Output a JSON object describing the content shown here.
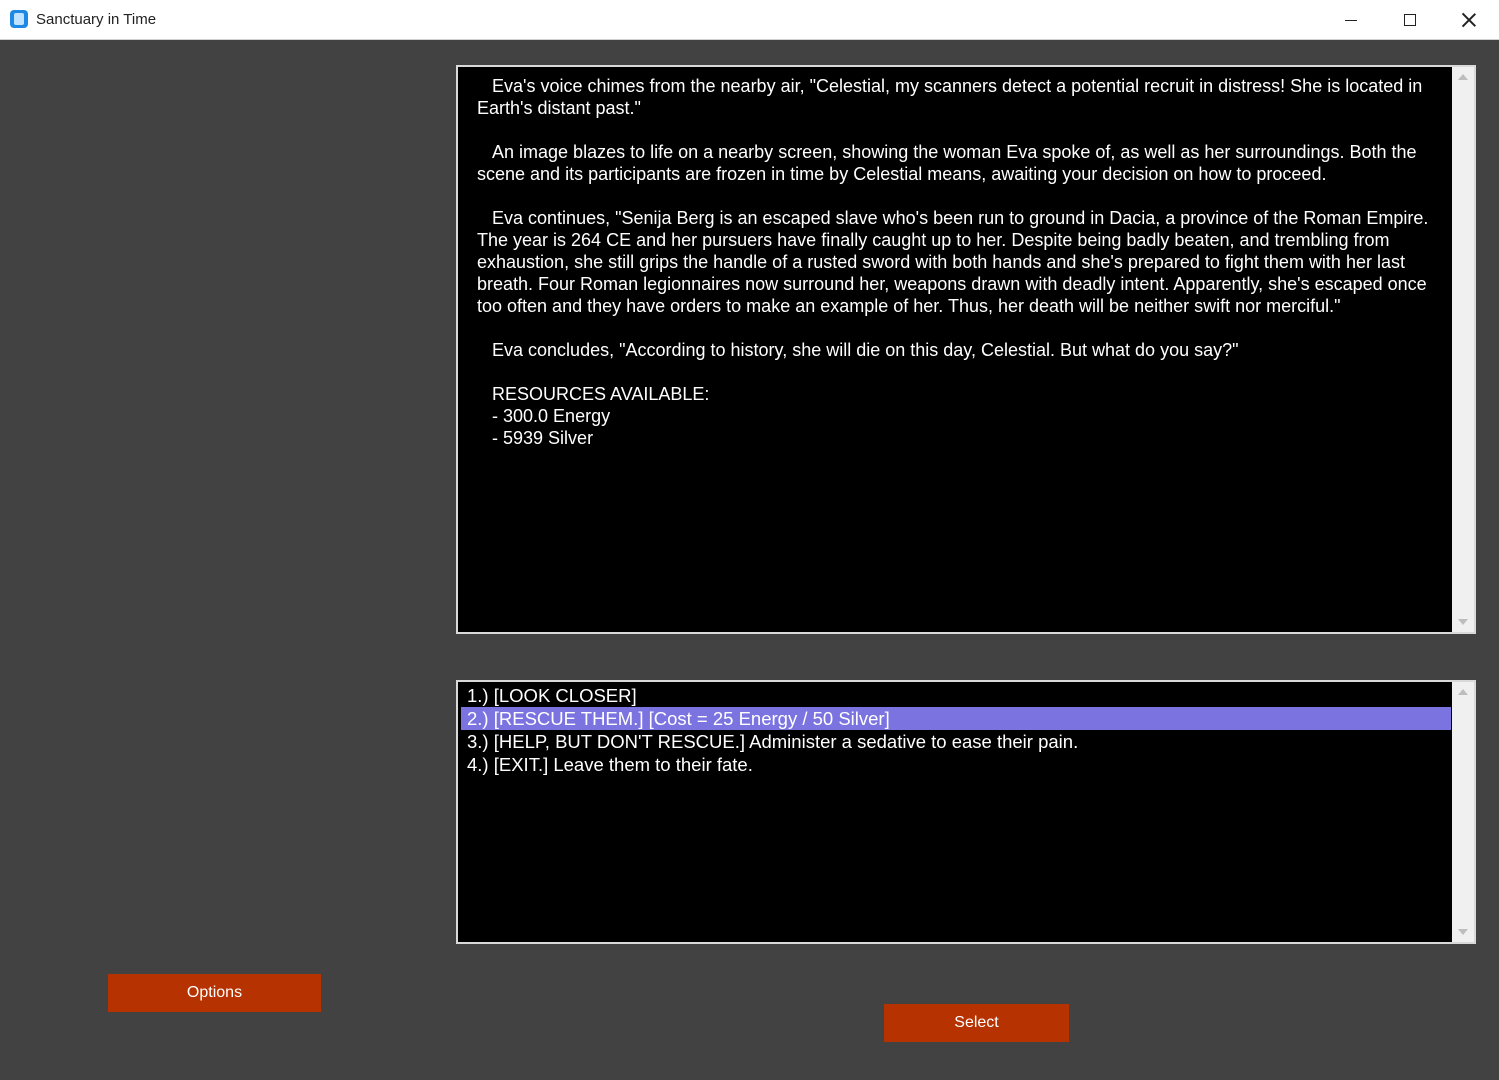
{
  "window": {
    "title": "Sanctuary in Time",
    "icon": "app-icon"
  },
  "story": {
    "text": "   Eva's voice chimes from the nearby air, \"Celestial, my scanners detect a potential recruit in distress! She is located in Earth's distant past.\"\n\n   An image blazes to life on a nearby screen, showing the woman Eva spoke of, as well as her surroundings. Both the scene and its participants are frozen in time by Celestial means, awaiting your decision on how to proceed.\n\n   Eva continues, \"Senija Berg is an escaped slave who's been run to ground in Dacia, a province of the Roman Empire. The year is 264 CE and her pursuers have finally caught up to her. Despite being badly beaten, and trembling from exhaustion, she still grips the handle of a rusted sword with both hands and she's prepared to fight them with her last breath. Four Roman legionnaires now surround her, weapons drawn with deadly intent. Apparently, she's escaped once too often and they have orders to make an example of her. Thus, her death will be neither swift nor merciful.\"\n\n   Eva concludes, \"According to history, she will die on this day, Celestial. But what do you say?\"\n\n   RESOURCES AVAILABLE:\n   - 300.0 Energy\n   - 5939 Silver"
  },
  "choices": [
    {
      "label": "1.) [LOOK CLOSER]",
      "selected": false
    },
    {
      "label": "2.) [RESCUE THEM.] [Cost = 25 Energy / 50 Silver]",
      "selected": true
    },
    {
      "label": "3.) [HELP, BUT DON'T RESCUE.] Administer a sedative to ease their pain.",
      "selected": false
    },
    {
      "label": "4.) [EXIT.] Leave them to their fate.",
      "selected": false
    }
  ],
  "buttons": {
    "options_label": "Options",
    "select_label": "Select"
  },
  "colors": {
    "background": "#424242",
    "panel": "#000000",
    "selection": "#7b73e0",
    "button": "#b63200"
  }
}
